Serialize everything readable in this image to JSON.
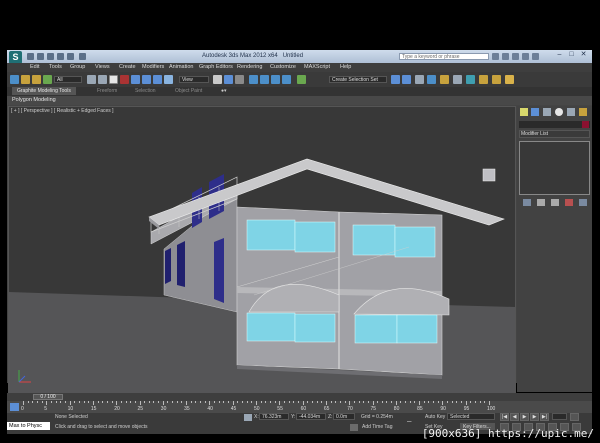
{
  "window": {
    "title_parts": [
      "Autodesk 3ds Max 2012 x64",
      "Untitled"
    ],
    "search_placeholder": "Type a keyword or phrase",
    "logo": "S",
    "controls": [
      "–",
      "□",
      "✕"
    ]
  },
  "menu": [
    "Edit",
    "Tools",
    "Group",
    "Views",
    "Create",
    "Modifiers",
    "Animation",
    "Graph Editors",
    "Rendering",
    "Customize",
    "MAXScript",
    "Help"
  ],
  "toolbar": {
    "selection_filter": "All",
    "reference_coord": "View",
    "named_selection": "Create Selection Set"
  },
  "ribbon": {
    "tabs": [
      "Graphite Modeling Tools",
      "Freeform",
      "Selection",
      "Object Paint"
    ],
    "panel": "Polygon Modeling"
  },
  "viewport": {
    "label": "[ + ] [ Perspective ] [ Realistic + Edged Faces ]"
  },
  "command_panel": {
    "modifier_list": "Modifier List",
    "object_color": "#8a1130"
  },
  "timeline": {
    "slider_label": "0 / 100",
    "ticks": [
      "0",
      "5",
      "10",
      "15",
      "20",
      "25",
      "30",
      "35",
      "40",
      "45",
      "50",
      "55",
      "60",
      "65",
      "70",
      "75",
      "80",
      "85",
      "90",
      "95",
      "100"
    ]
  },
  "status": {
    "selection": "None Selected",
    "prompt": "Click and drag to select and move objects",
    "x_label": "X:",
    "x_value": "76.323m",
    "y_label": "Y:",
    "y_value": "-44.034m",
    "z_label": "Z:",
    "z_value": "0.0m",
    "grid": "Grid = 0.254m",
    "add_time_tag": "Add Time Tag",
    "auto_key": "Auto Key",
    "auto_key_mode": "Selected",
    "set_key": "Set Key",
    "key_filters": "Key Filters...",
    "maxscript": "Max to Physc"
  },
  "watermark": "[900x636] https://upic.me/"
}
